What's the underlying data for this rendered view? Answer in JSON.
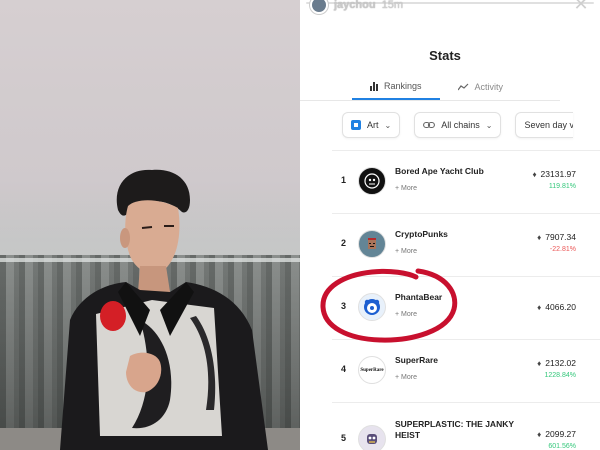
{
  "story": {
    "username": "jaychou",
    "time": "15m",
    "close_icon": "close-icon"
  },
  "stats": {
    "title": "Stats",
    "tabs": [
      {
        "label": "Rankings",
        "icon": "bar-chart-icon",
        "active": true
      },
      {
        "label": "Activity",
        "icon": "trend-line-icon",
        "active": false
      }
    ],
    "filters": [
      {
        "label": "Art",
        "icon": "art-category-icon"
      },
      {
        "label": "All chains",
        "icon": "link-icon"
      },
      {
        "label": "Seven day v",
        "icon": ""
      }
    ],
    "more_label": "+ More",
    "eth_symbol": "♦",
    "collections": [
      {
        "rank": "1",
        "name": "Bored Ape Yacht Club",
        "volume": "23131.97",
        "change": "119.81%",
        "change_dir": "pos"
      },
      {
        "rank": "2",
        "name": "CryptoPunks",
        "volume": "7907.34",
        "change": "-22.81%",
        "change_dir": "neg"
      },
      {
        "rank": "3",
        "name": "PhantaBear",
        "volume": "4066.20",
        "change": "",
        "change_dir": "none"
      },
      {
        "rank": "4",
        "name": "SuperRare",
        "volume": "2132.02",
        "change": "1228.84%",
        "change_dir": "pos"
      },
      {
        "rank": "5",
        "name": "SUPERPLASTIC: THE JANKY HEIST",
        "volume": "2099.27",
        "change": "601.56%",
        "change_dir": "pos"
      }
    ],
    "logo_texts": {
      "superrare": "SuperRare"
    }
  },
  "colors": {
    "accent": "#2081e2",
    "positive": "#34c77b",
    "negative": "#eb5757",
    "annotation": "#c8102e"
  }
}
